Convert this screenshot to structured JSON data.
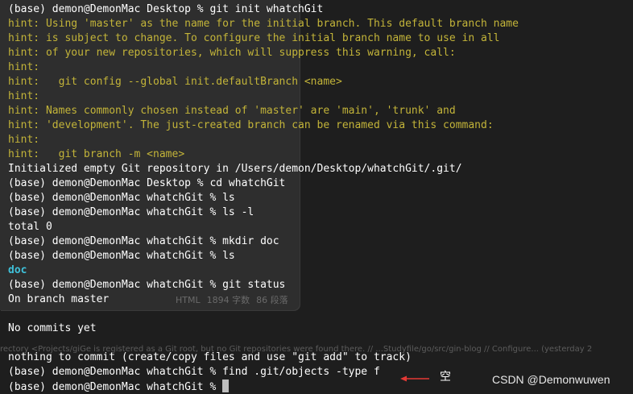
{
  "terminal": {
    "lines": [
      {
        "kind": "prompt",
        "text": "(base) demon@DemonMac Desktop % git init whatchGit"
      },
      {
        "kind": "hint",
        "text": "hint: Using 'master' as the name for the initial branch. This default branch name"
      },
      {
        "kind": "hint",
        "text": "hint: is subject to change. To configure the initial branch name to use in all"
      },
      {
        "kind": "hint",
        "text": "hint: of your new repositories, which will suppress this warning, call:"
      },
      {
        "kind": "hint",
        "text": "hint:"
      },
      {
        "kind": "hint",
        "text": "hint:   git config --global init.defaultBranch <name>"
      },
      {
        "kind": "hint",
        "text": "hint:"
      },
      {
        "kind": "hint",
        "text": "hint: Names commonly chosen instead of 'master' are 'main', 'trunk' and"
      },
      {
        "kind": "hint",
        "text": "hint: 'development'. The just-created branch can be renamed via this command:"
      },
      {
        "kind": "hint",
        "text": "hint:"
      },
      {
        "kind": "hint",
        "text": "hint:   git branch -m <name>"
      },
      {
        "kind": "output",
        "text": "Initialized empty Git repository in /Users/demon/Desktop/whatchGit/.git/"
      },
      {
        "kind": "prompt",
        "text": "(base) demon@DemonMac Desktop % cd whatchGit"
      },
      {
        "kind": "prompt",
        "text": "(base) demon@DemonMac whatchGit % ls"
      },
      {
        "kind": "prompt",
        "text": "(base) demon@DemonMac whatchGit % ls -l"
      },
      {
        "kind": "output",
        "text": "total 0"
      },
      {
        "kind": "prompt",
        "text": "(base) demon@DemonMac whatchGit % mkdir doc"
      },
      {
        "kind": "prompt",
        "text": "(base) demon@DemonMac whatchGit % ls"
      },
      {
        "kind": "dir",
        "text": "doc"
      },
      {
        "kind": "prompt",
        "text": "(base) demon@DemonMac whatchGit % git status"
      },
      {
        "kind": "output",
        "text": "On branch master"
      },
      {
        "kind": "output",
        "text": ""
      },
      {
        "kind": "output",
        "text": "No commits yet"
      },
      {
        "kind": "output",
        "text": ""
      },
      {
        "kind": "output",
        "text": "nothing to commit (create/copy files and use \"git add\" to track)"
      },
      {
        "kind": "prompt",
        "text": "(base) demon@DemonMac whatchGit % find .git/objects -type f"
      },
      {
        "kind": "prompt",
        "text": "(base) demon@DemonMac whatchGit % "
      }
    ]
  },
  "background": {
    "editor_mode": "HTML",
    "word_count": "1894 字数",
    "paragraph_count": "86 段落",
    "ghost_line": "rectory <Projects/giGe is registered as a Git root, but no Git repositories were found there. // ...Studyfile/go/src/gin-blog // Configure... (yesterday 2"
  },
  "annotation": {
    "note": "空",
    "arrow_color": "#e53935"
  },
  "watermark": "CSDN @Demonwuwen",
  "colors": {
    "hint": "#c3b439",
    "dir": "#3fc1da",
    "text": "#ffffff",
    "background": "#1e1e1e"
  }
}
